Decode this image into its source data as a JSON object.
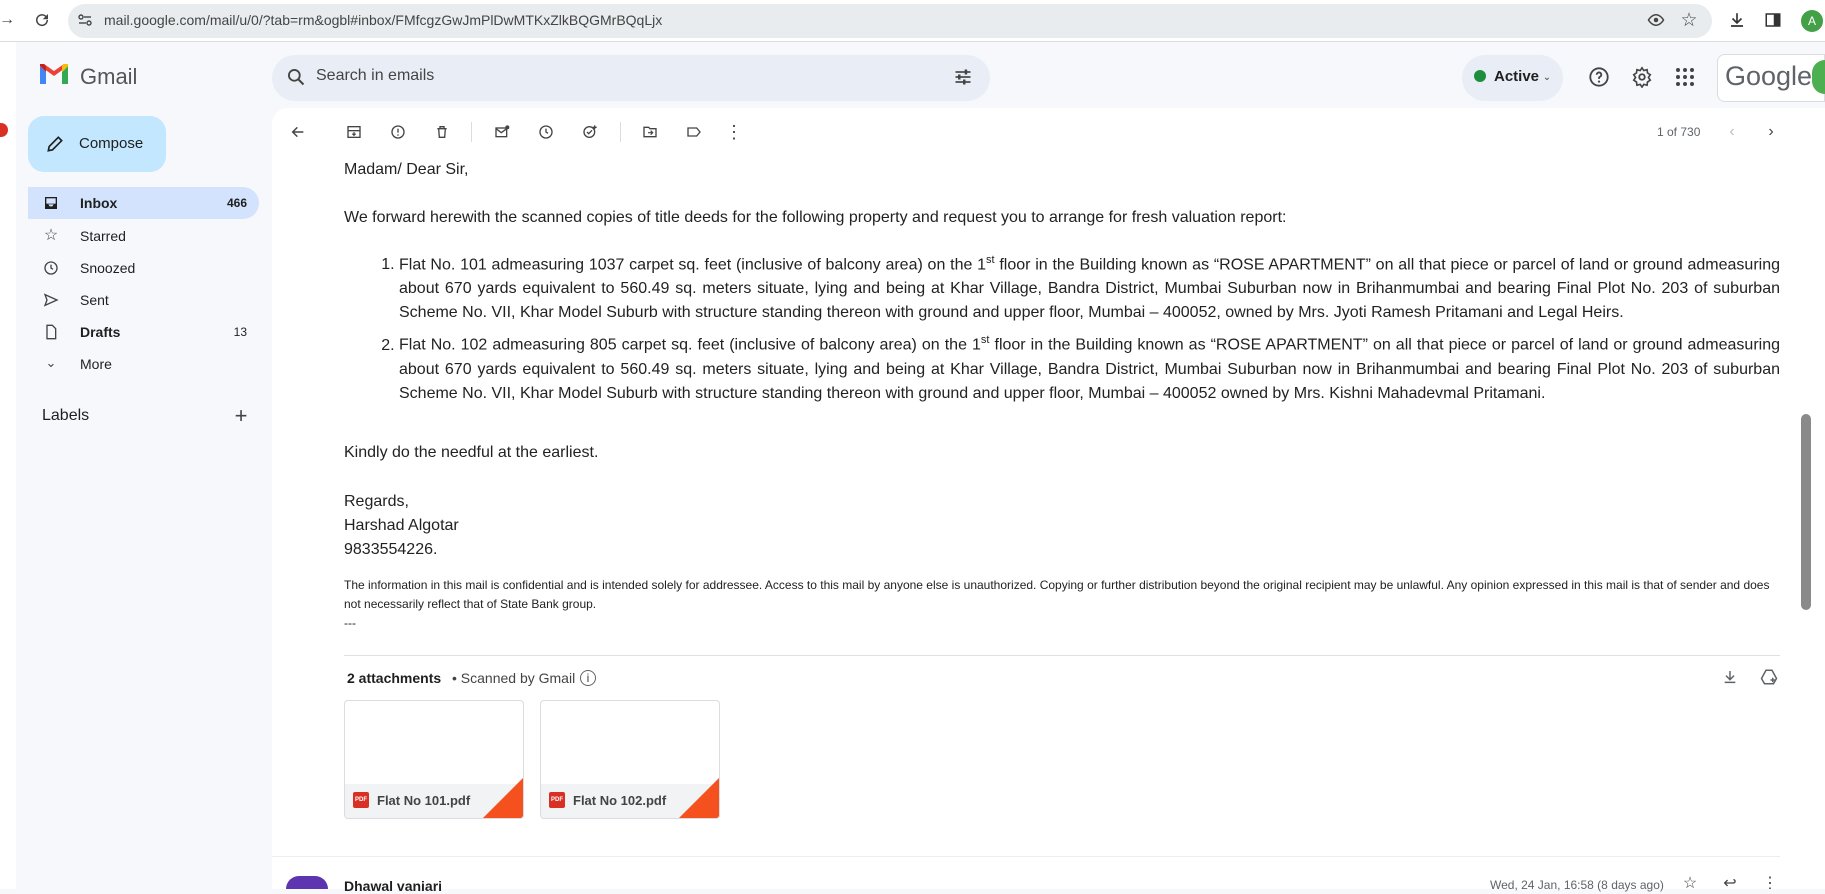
{
  "browser": {
    "url": "mail.google.com/mail/u/0/?tab=rm&ogbl#inbox/FMfcgzGwJmPlDwMTKxZlkBQGMrBQqLjx",
    "profile_initial": "A"
  },
  "app": {
    "name": "Gmail",
    "brand_word": "Google"
  },
  "search": {
    "placeholder": "Search in emails"
  },
  "status": {
    "label": "Active",
    "color": "#1e8e3e"
  },
  "compose": {
    "label": "Compose"
  },
  "sidebar": {
    "items": [
      {
        "label": "Inbox",
        "count": "466",
        "icon": "inbox-icon",
        "active": true
      },
      {
        "label": "Starred",
        "count": "",
        "icon": "star-icon"
      },
      {
        "label": "Snoozed",
        "count": "",
        "icon": "clock-icon"
      },
      {
        "label": "Sent",
        "count": "",
        "icon": "send-icon"
      },
      {
        "label": "Drafts",
        "count": "13",
        "icon": "draft-icon"
      },
      {
        "label": "More",
        "count": "",
        "icon": "chevron-down-icon"
      }
    ],
    "labels_title": "Labels"
  },
  "toolbar": {
    "counter": "1 of 730"
  },
  "email": {
    "greeting": "Madam/ Dear Sir,",
    "intro": "We forward herewith the scanned copies of title deeds for the following property and request you to arrange for fresh valuation report:",
    "items": [
      {
        "before": "Flat No. 101 admeasuring 1037 carpet sq. feet (inclusive of balcony area) on the 1",
        "sup": "st",
        "after": " floor in the Building known as “ROSE APARTMENT” on all that piece or parcel of land or ground admeasuring about 670 yards equivalent to 560.49 sq. meters situate, lying and being at Khar Village, Bandra District, Mumbai Suburban now in Brihanmumbai and bearing Final Plot No. 203 of suburban Scheme No. VII, Khar Model Suburb with structure standing thereon with ground and upper floor, Mumbai – 400052, owned by Mrs. Jyoti Ramesh Pritamani and Legal Heirs."
      },
      {
        "before": "Flat No. 102 admeasuring 805 carpet sq. feet (inclusive of balcony area) on the 1",
        "sup": "st",
        "after": " floor in the Building known as “ROSE APARTMENT” on all that piece or parcel of land or ground admeasuring about 670 yards equivalent to 560.49 sq. meters situate, lying and being at Khar Village, Bandra District, Mumbai Suburban now in Brihanmumbai and bearing Final Plot No. 203 of suburban Scheme No. VII, Khar Model Suburb with structure standing thereon with ground and upper floor, Mumbai – 400052 owned by Mrs. Kishni Mahadevmal Pritamani."
      }
    ],
    "closing": "Kindly do the needful at the earliest.",
    "regards": "Regards,",
    "signature_name": "Harshad Algotar",
    "signature_phone": "9833554226.",
    "disclaimer": "The information in this mail is confidential and is intended solely for addressee. Access to this mail by anyone else is unauthorized. Copying or further distribution beyond the original recipient may be unlawful. Any opinion expressed in this mail is that of sender and does not necessarily reflect that of State Bank group.",
    "dashes": "---"
  },
  "attachments": {
    "title": "2 attachments",
    "scan_note": "• Scanned by Gmail",
    "files": [
      {
        "name": "Flat No 101.pdf",
        "type": "PDF"
      },
      {
        "name": "Flat No 102.pdf",
        "type": "PDF"
      }
    ]
  },
  "next_message": {
    "sender": "Dhawal vaniari",
    "date": "Wed, 24 Jan, 16:58 (8 days ago)"
  }
}
